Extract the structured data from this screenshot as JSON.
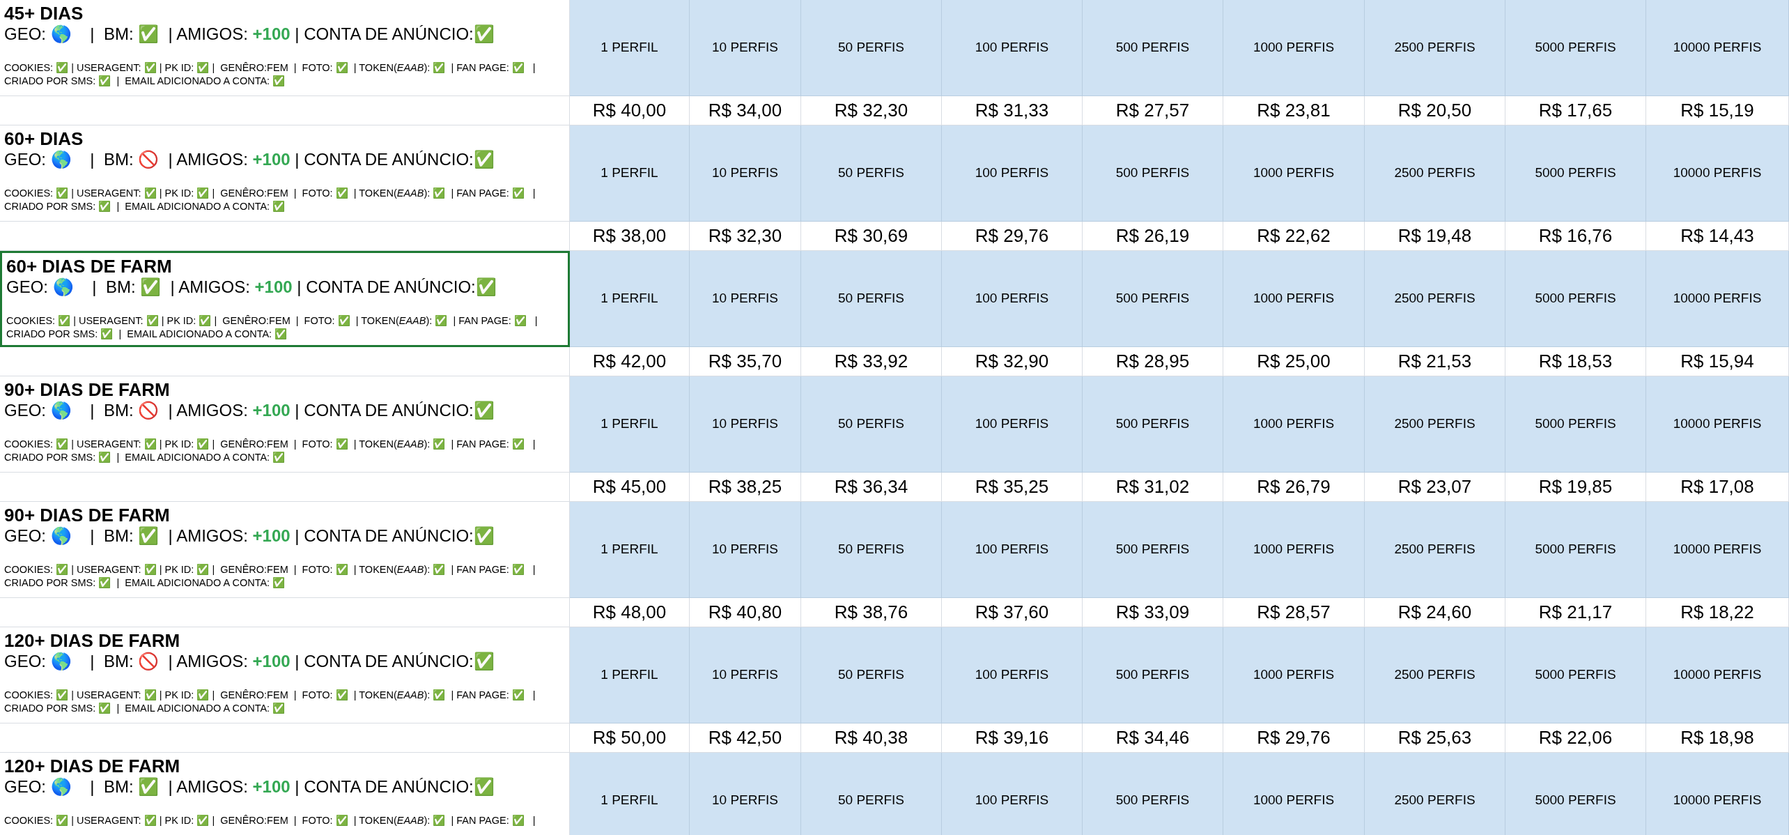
{
  "blocks": [
    {
      "title": "45+ DIAS",
      "selected": false,
      "summary": {
        "before": "GEO: 🌎    |  BM: ✅  | AMIGOS: ",
        "highlight": "+100",
        "after": " | CONTA DE ANÚNCIO:✅"
      },
      "details": [
        "COOKIES: ✅ | USERAGENT: ✅ | PK ID: ✅ |  GENÊRO:FEM  |  FOTO: ✅  | TOKEN(*EAAB*): ✅  | FAN PAGE: ✅   |",
        "CRIADO POR SMS: ✅  |  EMAIL ADICIONADO A CONTA: ✅"
      ],
      "tiers": [
        "1 PERFIL",
        "10 PERFIS",
        "50 PERFIS",
        "100 PERFIS",
        "500 PERFIS",
        "1000 PERFIS",
        "2500 PERFIS",
        "5000 PERFIS",
        "10000 PERFIS"
      ],
      "prices": [
        "R$ 40,00",
        "R$ 34,00",
        "R$ 32,30",
        "R$ 31,33",
        "R$ 27,57",
        "R$ 23,81",
        "R$ 20,50",
        "R$ 17,65",
        "R$ 15,19"
      ]
    },
    {
      "title": "60+ DIAS",
      "selected": false,
      "summary": {
        "before": "GEO: 🌎    |  BM: 🚫  | AMIGOS: ",
        "highlight": "+100",
        "after": " | CONTA DE ANÚNCIO:✅"
      },
      "details": [
        "COOKIES: ✅ | USERAGENT: ✅ | PK ID: ✅ |  GENÊRO:FEM  |  FOTO: ✅  | TOKEN(*EAAB*): ✅  | FAN PAGE: ✅   |",
        "CRIADO POR SMS: ✅  |  EMAIL ADICIONADO A CONTA: ✅"
      ],
      "tiers": [
        "1 PERFIL",
        "10 PERFIS",
        "50 PERFIS",
        "100 PERFIS",
        "500 PERFIS",
        "1000 PERFIS",
        "2500 PERFIS",
        "5000 PERFIS",
        "10000 PERFIS"
      ],
      "prices": [
        "R$ 38,00",
        "R$ 32,30",
        "R$ 30,69",
        "R$ 29,76",
        "R$ 26,19",
        "R$ 22,62",
        "R$ 19,48",
        "R$ 16,76",
        "R$ 14,43"
      ]
    },
    {
      "title": "60+ DIAS DE FARM",
      "selected": true,
      "summary": {
        "before": "GEO: 🌎    |  BM: ✅  | AMIGOS: ",
        "highlight": "+100",
        "after": " | CONTA DE ANÚNCIO:✅"
      },
      "details": [
        "COOKIES: ✅ | USERAGENT: ✅ | PK ID: ✅ |  GENÊRO:FEM  |  FOTO: ✅  | TOKEN(*EAAB*): ✅  | FAN PAGE: ✅   |",
        "CRIADO POR SMS: ✅  |  EMAIL ADICIONADO A CONTA: ✅"
      ],
      "tiers": [
        "1 PERFIL",
        "10 PERFIS",
        "50 PERFIS",
        "100 PERFIS",
        "500 PERFIS",
        "1000 PERFIS",
        "2500 PERFIS",
        "5000 PERFIS",
        "10000 PERFIS"
      ],
      "prices": [
        "R$ 42,00",
        "R$ 35,70",
        "R$ 33,92",
        "R$ 32,90",
        "R$ 28,95",
        "R$ 25,00",
        "R$ 21,53",
        "R$ 18,53",
        "R$ 15,94"
      ]
    },
    {
      "title": "90+ DIAS DE FARM",
      "selected": false,
      "summary": {
        "before": "GEO: 🌎    |  BM: 🚫  | AMIGOS: ",
        "highlight": "+100",
        "after": " | CONTA DE ANÚNCIO:✅"
      },
      "details": [
        "COOKIES: ✅ | USERAGENT: ✅ | PK ID: ✅ |  GENÊRO:FEM  |  FOTO: ✅  | TOKEN(*EAAB*): ✅  | FAN PAGE: ✅   |",
        "CRIADO POR SMS: ✅  |  EMAIL ADICIONADO A CONTA: ✅"
      ],
      "tiers": [
        "1 PERFIL",
        "10 PERFIS",
        "50 PERFIS",
        "100 PERFIS",
        "500 PERFIS",
        "1000 PERFIS",
        "2500 PERFIS",
        "5000 PERFIS",
        "10000 PERFIS"
      ],
      "prices": [
        "R$ 45,00",
        "R$ 38,25",
        "R$ 36,34",
        "R$ 35,25",
        "R$ 31,02",
        "R$ 26,79",
        "R$ 23,07",
        "R$ 19,85",
        "R$ 17,08"
      ]
    },
    {
      "title": "90+ DIAS DE FARM",
      "selected": false,
      "summary": {
        "before": "GEO: 🌎    |  BM: ✅  | AMIGOS: ",
        "highlight": "+100",
        "after": " | CONTA DE ANÚNCIO:✅"
      },
      "details": [
        "COOKIES: ✅ | USERAGENT: ✅ | PK ID: ✅ |  GENÊRO:FEM  |  FOTO: ✅  | TOKEN(*EAAB*): ✅  | FAN PAGE: ✅   |",
        "CRIADO POR SMS: ✅  |  EMAIL ADICIONADO A CONTA: ✅"
      ],
      "tiers": [
        "1 PERFIL",
        "10 PERFIS",
        "50 PERFIS",
        "100 PERFIS",
        "500 PERFIS",
        "1000 PERFIS",
        "2500 PERFIS",
        "5000 PERFIS",
        "10000 PERFIS"
      ],
      "prices": [
        "R$ 48,00",
        "R$ 40,80",
        "R$ 38,76",
        "R$ 37,60",
        "R$ 33,09",
        "R$ 28,57",
        "R$ 24,60",
        "R$ 21,17",
        "R$ 18,22"
      ]
    },
    {
      "title": "120+ DIAS DE FARM",
      "selected": false,
      "summary": {
        "before": "GEO: 🌎    |  BM: 🚫  | AMIGOS: ",
        "highlight": "+100",
        "after": " | CONTA DE ANÚNCIO:✅"
      },
      "details": [
        "COOKIES: ✅ | USERAGENT: ✅ | PK ID: ✅ |  GENÊRO:FEM  |  FOTO: ✅  | TOKEN(*EAAB*): ✅  | FAN PAGE: ✅   |",
        "CRIADO POR SMS: ✅  |  EMAIL ADICIONADO A CONTA: ✅"
      ],
      "tiers": [
        "1 PERFIL",
        "10 PERFIS",
        "50 PERFIS",
        "100 PERFIS",
        "500 PERFIS",
        "1000 PERFIS",
        "2500 PERFIS",
        "5000 PERFIS",
        "10000 PERFIS"
      ],
      "prices": [
        "R$ 50,00",
        "R$ 42,50",
        "R$ 40,38",
        "R$ 39,16",
        "R$ 34,46",
        "R$ 29,76",
        "R$ 25,63",
        "R$ 22,06",
        "R$ 18,98"
      ]
    },
    {
      "title": "120+ DIAS DE FARM",
      "selected": false,
      "summary": {
        "before": "GEO: 🌎    |  BM: ✅  | AMIGOS: ",
        "highlight": "+100",
        "after": " | CONTA DE ANÚNCIO:✅"
      },
      "details": [
        "COOKIES: ✅ | USERAGENT: ✅ | PK ID: ✅ |  GENÊRO:FEM  |  FOTO: ✅  | TOKEN(*EAAB*): ✅  | FAN PAGE: ✅   |"
      ],
      "tiers": [
        "1 PERFIL",
        "10 PERFIS",
        "50 PERFIS",
        "100 PERFIS",
        "500 PERFIS",
        "1000 PERFIS",
        "2500 PERFIS",
        "5000 PERFIS",
        "10000 PERFIS"
      ]
    }
  ]
}
